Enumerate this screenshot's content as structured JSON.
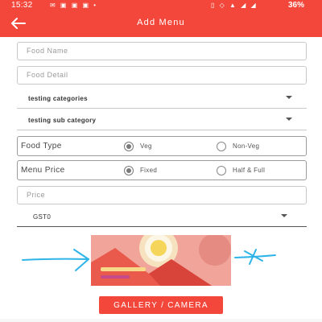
{
  "status_bar": {
    "time": "15:32",
    "left_icons": "✉ ▣ ▣ ▣ •",
    "right_icons": "▯ ◇ ▲ ◢ ◢",
    "battery": "36%"
  },
  "app_bar": {
    "title": "Add Menu",
    "back_icon": "arrow-left-icon"
  },
  "form": {
    "food_name_placeholder": "Food Name",
    "food_detail_placeholder": "Food Detail",
    "category_value": "testing categories",
    "sub_category_value": "testing sub category",
    "food_type": {
      "label": "Food Type",
      "options": [
        "Veg",
        "Non-Veg"
      ],
      "selected": "Veg"
    },
    "menu_price": {
      "label": "Menu Price",
      "options": [
        "Fixed",
        "Half & Full"
      ],
      "selected": "Fixed"
    },
    "price_placeholder": "Price",
    "tax_value": "GST0"
  },
  "image_picker": {
    "button_label": "GALLERY / CAMERA"
  },
  "colors": {
    "primary": "#f4473b",
    "image_bg": "#f0a49a",
    "annotation": "#2fb4e8"
  }
}
